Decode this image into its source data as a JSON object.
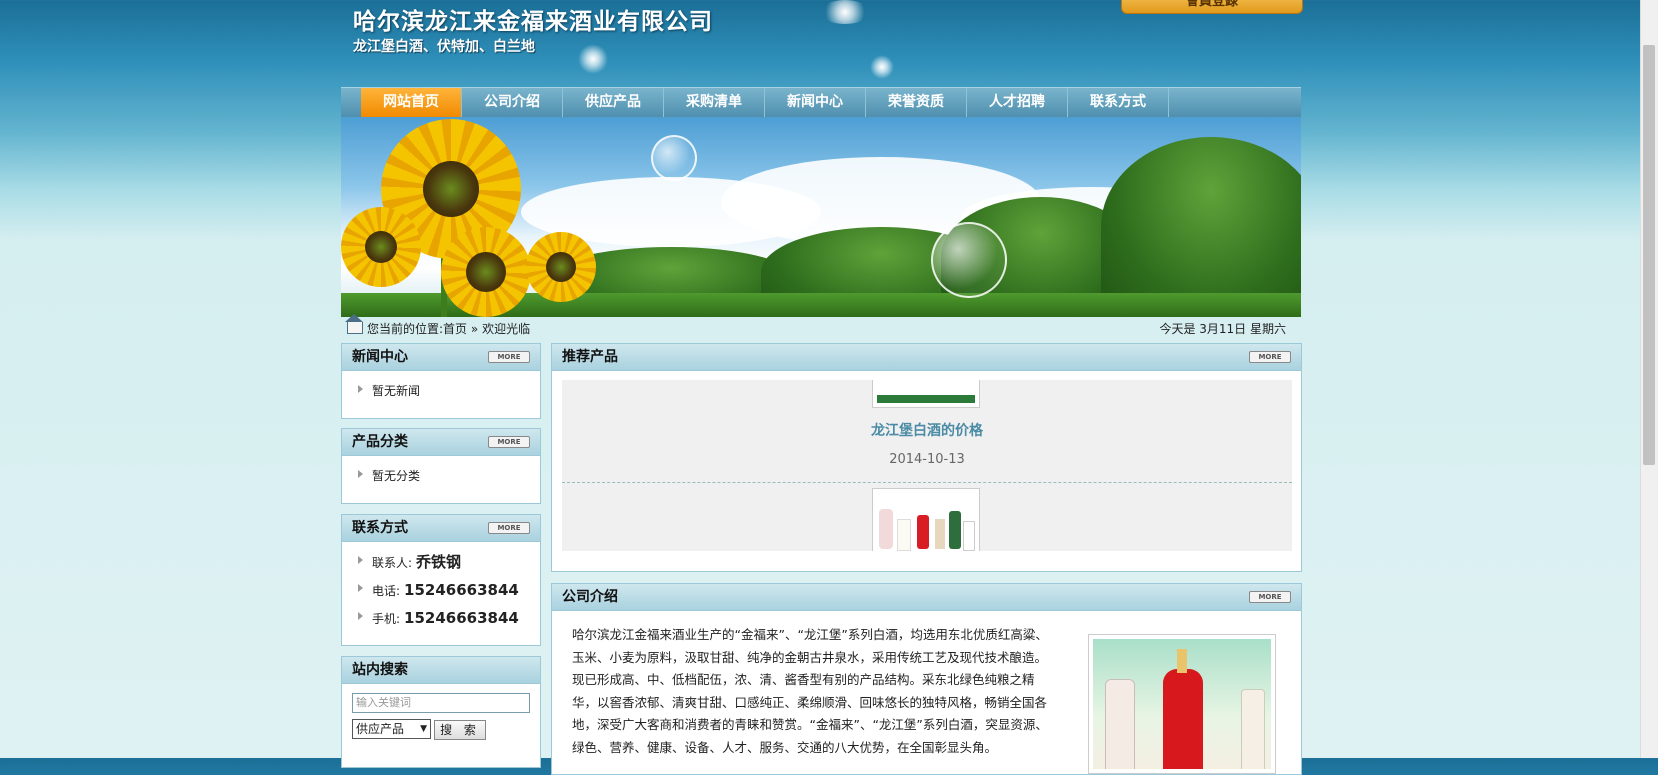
{
  "header": {
    "title": "哈尔滨龙江来金福来酒业有限公司",
    "subtitle": "龙江堡白酒、伏特加、白兰地",
    "top_button": "會員登錄"
  },
  "nav": [
    "网站首页",
    "公司介绍",
    "供应产品",
    "采购清单",
    "新闻中心",
    "荣誉资质",
    "人才招聘",
    "联系方式"
  ],
  "location": {
    "label": "您当前的位置:",
    "home": "首页",
    "sep": "»",
    "current": "欢迎光临",
    "date": "今天是 3月11日 星期六"
  },
  "more_label": "MORE",
  "news": {
    "title": "新闻中心",
    "items": [
      "暂无新闻"
    ]
  },
  "categories": {
    "title": "产品分类",
    "items": [
      "暂无分类"
    ]
  },
  "contact": {
    "title": "联系方式",
    "person_label": "联系人:",
    "person": "乔铁钢",
    "phone_label": "电话:",
    "phone": "15246663844",
    "mobile_label": "手机:",
    "mobile": "15246663844"
  },
  "search": {
    "title": "站内搜索",
    "placeholder": "输入关键词",
    "select_value": "供应产品",
    "button": "搜 索"
  },
  "recommended": {
    "title": "推荐产品",
    "product_title": "龙江堡白酒的价格",
    "product_date": "2014-10-13"
  },
  "intro": {
    "title": "公司介绍",
    "text": "哈尔滨龙江金福来酒业生产的“金福来”、“龙江堡”系列白酒，均选用东北优质红高粱、玉米、小麦为原料，汲取甘甜、纯净的金朝古井泉水，采用传统工艺及现代技术酿造。现已形成高、中、低档配伍，浓、清、酱香型有别的产品结构。采东北绿色纯粮之精华，以窖香浓郁、清爽甘甜、口感纯正、柔绵顺滑、回味悠长的独特风格，畅销全国各地，深受广大客商和消费者的青睐和赞赏。“金福来”、“龙江堡”系列白酒，突显资源、绿色、营养、健康、设备、人才、服务、交通的八大优势，在全国彰显头角。"
  }
}
